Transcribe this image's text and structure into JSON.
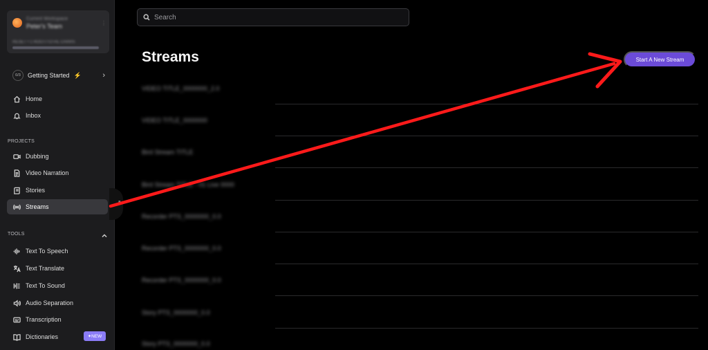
{
  "team": {
    "org": "Current Workspace",
    "name": "Peter's Team",
    "usage": "RESET • 1 ROOT/TOTAL CHARS",
    "usage_fraction": 0.95
  },
  "getting_started": {
    "progress": "0/3",
    "label": "Getting Started",
    "bolt": "⚡",
    "chevron": "›"
  },
  "nav": {
    "home": "Home",
    "inbox": "Inbox"
  },
  "projects": {
    "heading": "PROJECTS",
    "items": [
      "Dubbing",
      "Video Narration",
      "Stories",
      "Streams"
    ]
  },
  "tools": {
    "heading": "TOOLS",
    "items": [
      "Text To Speech",
      "Text Translate",
      "Text To Sound",
      "Audio Separation",
      "Transcription",
      "Dictionaries"
    ],
    "new_badge": "✦NEW"
  },
  "search": {
    "placeholder": "Search"
  },
  "page": {
    "title": "Streams",
    "primary_button": "Start A New Stream"
  },
  "streams": [
    "VIDEO TITLE_0000000_2.0",
    "VIDEO TITLE_0000000",
    "Bird Stream TITLE",
    "Bird Stream TITLE - 01 Live 0000",
    "Recorder PTS_0000000_0.0",
    "Recorder PTS_0000000_0.0",
    "Recorder PTS_0000000_0.0",
    "Story PTS_0000000_0.0",
    "Story PTS_0000000_0.0"
  ],
  "colors": {
    "accent": "#6b4bd8",
    "badge": "#8b7cf6",
    "annotation": "#ff1a1a"
  }
}
